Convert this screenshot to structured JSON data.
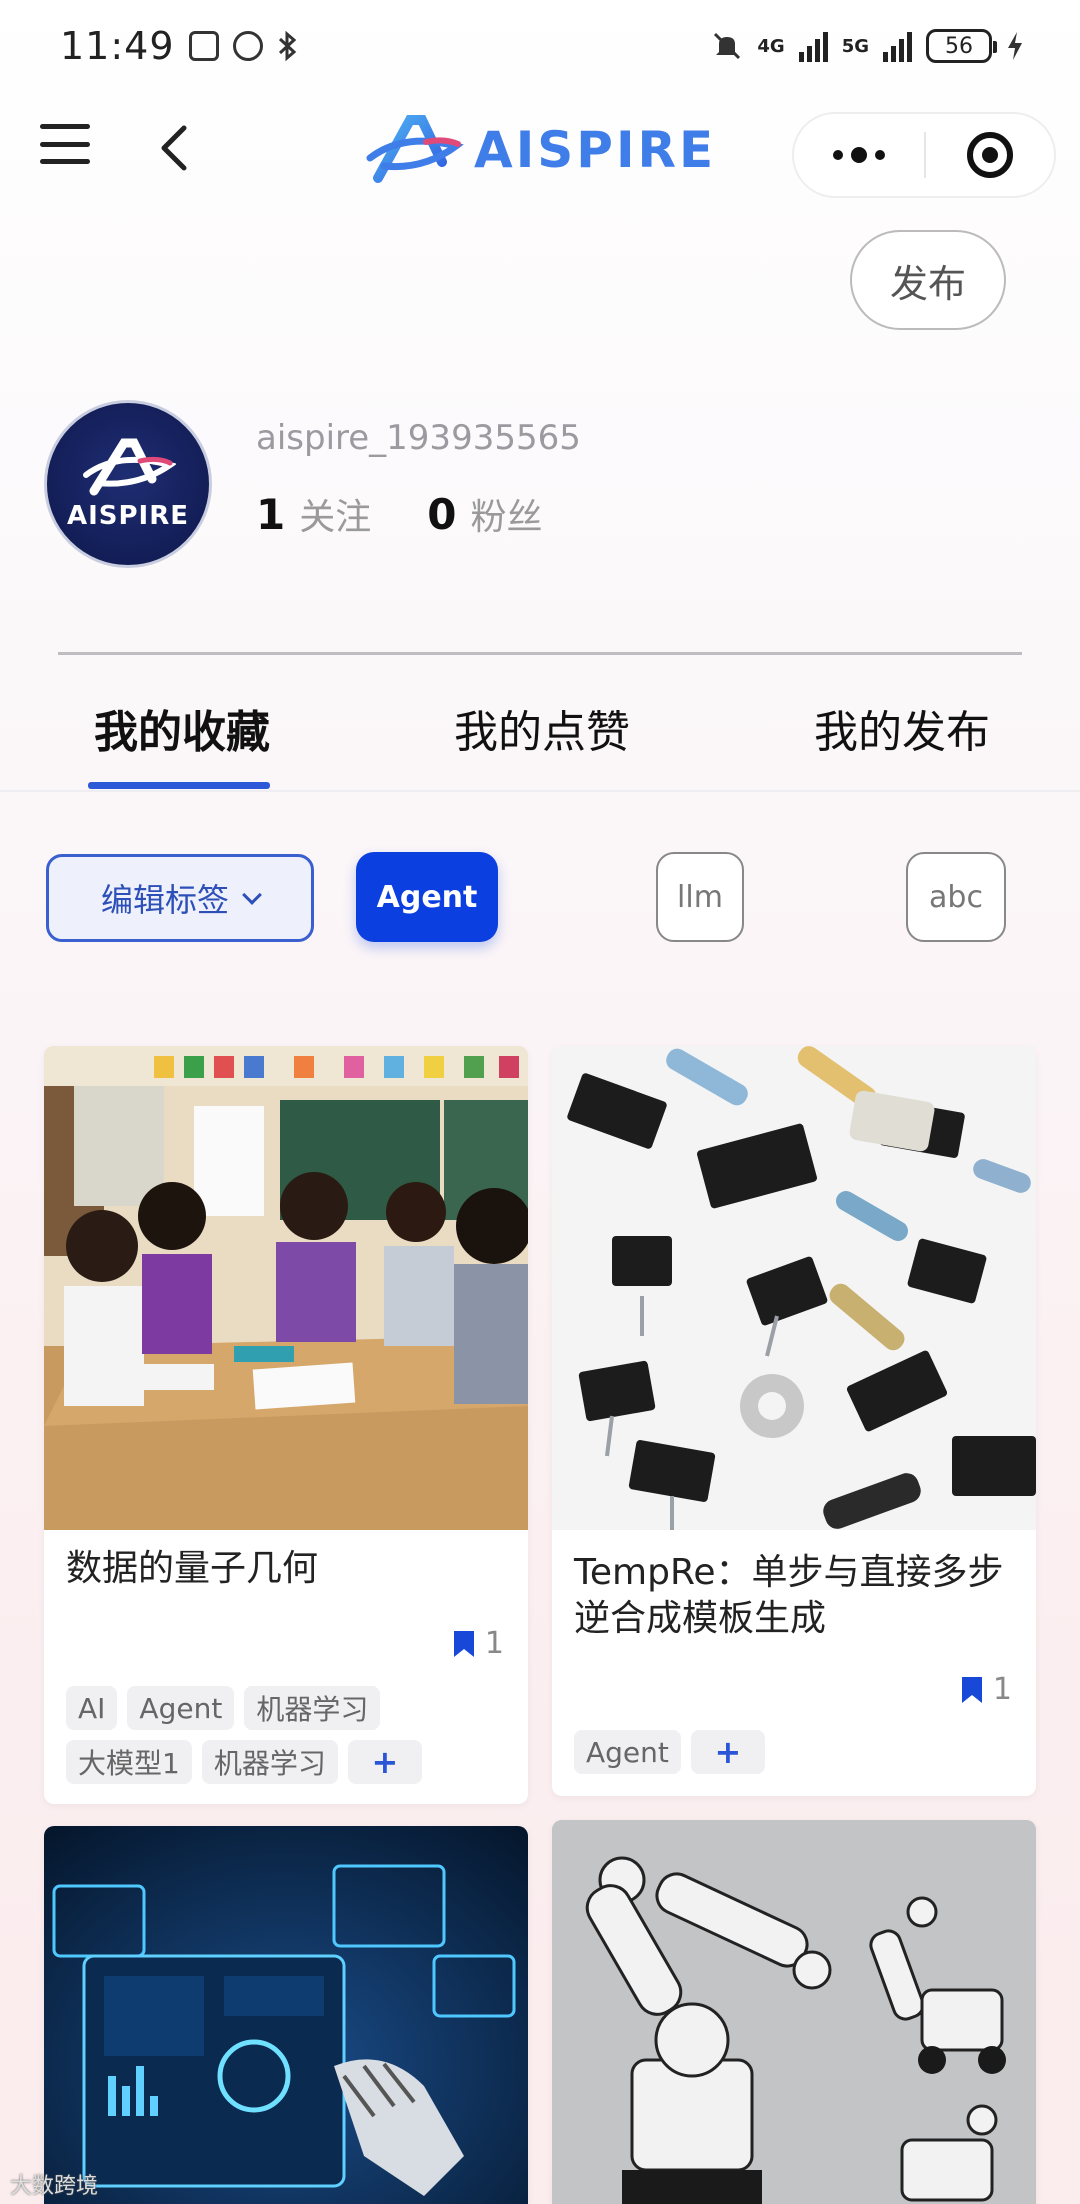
{
  "status_bar": {
    "time": "11:49",
    "network_4g": "4G",
    "network_5g": "5G",
    "battery": "56"
  },
  "nav": {
    "logo_text": "AISPIRE"
  },
  "publish_label": "发布",
  "profile": {
    "avatar_text": "AISPIRE",
    "username": "aispire_193935565",
    "following_count": "1",
    "following_label": "关注",
    "followers_count": "0",
    "followers_label": "粉丝"
  },
  "tabs": [
    {
      "label": "我的收藏",
      "active": true
    },
    {
      "label": "我的点赞",
      "active": false
    },
    {
      "label": "我的发布",
      "active": false
    }
  ],
  "filters": {
    "edit_tags_label": "编辑标签",
    "chips": [
      {
        "label": "Agent",
        "active": true
      },
      {
        "label": "llm",
        "active": false
      },
      {
        "label": "abc",
        "active": false
      }
    ]
  },
  "cards": [
    {
      "title": "数据的量子几何",
      "bookmark_count": "1",
      "tags": [
        "AI",
        "Agent",
        "机器学习",
        "大模型1",
        "机器学习"
      ],
      "add_label": "+"
    },
    {
      "title": "TempRe：单步与直接多步逆合成模板生成",
      "bookmark_count": "1",
      "tags": [
        "Agent"
      ],
      "add_label": "+"
    },
    {
      "title": ""
    },
    {
      "title": ""
    }
  ],
  "watermark": "大数跨境",
  "colors": {
    "accent": "#0c3fe0",
    "tab_indicator": "#2d58d8",
    "logo": "#3f7de8"
  }
}
